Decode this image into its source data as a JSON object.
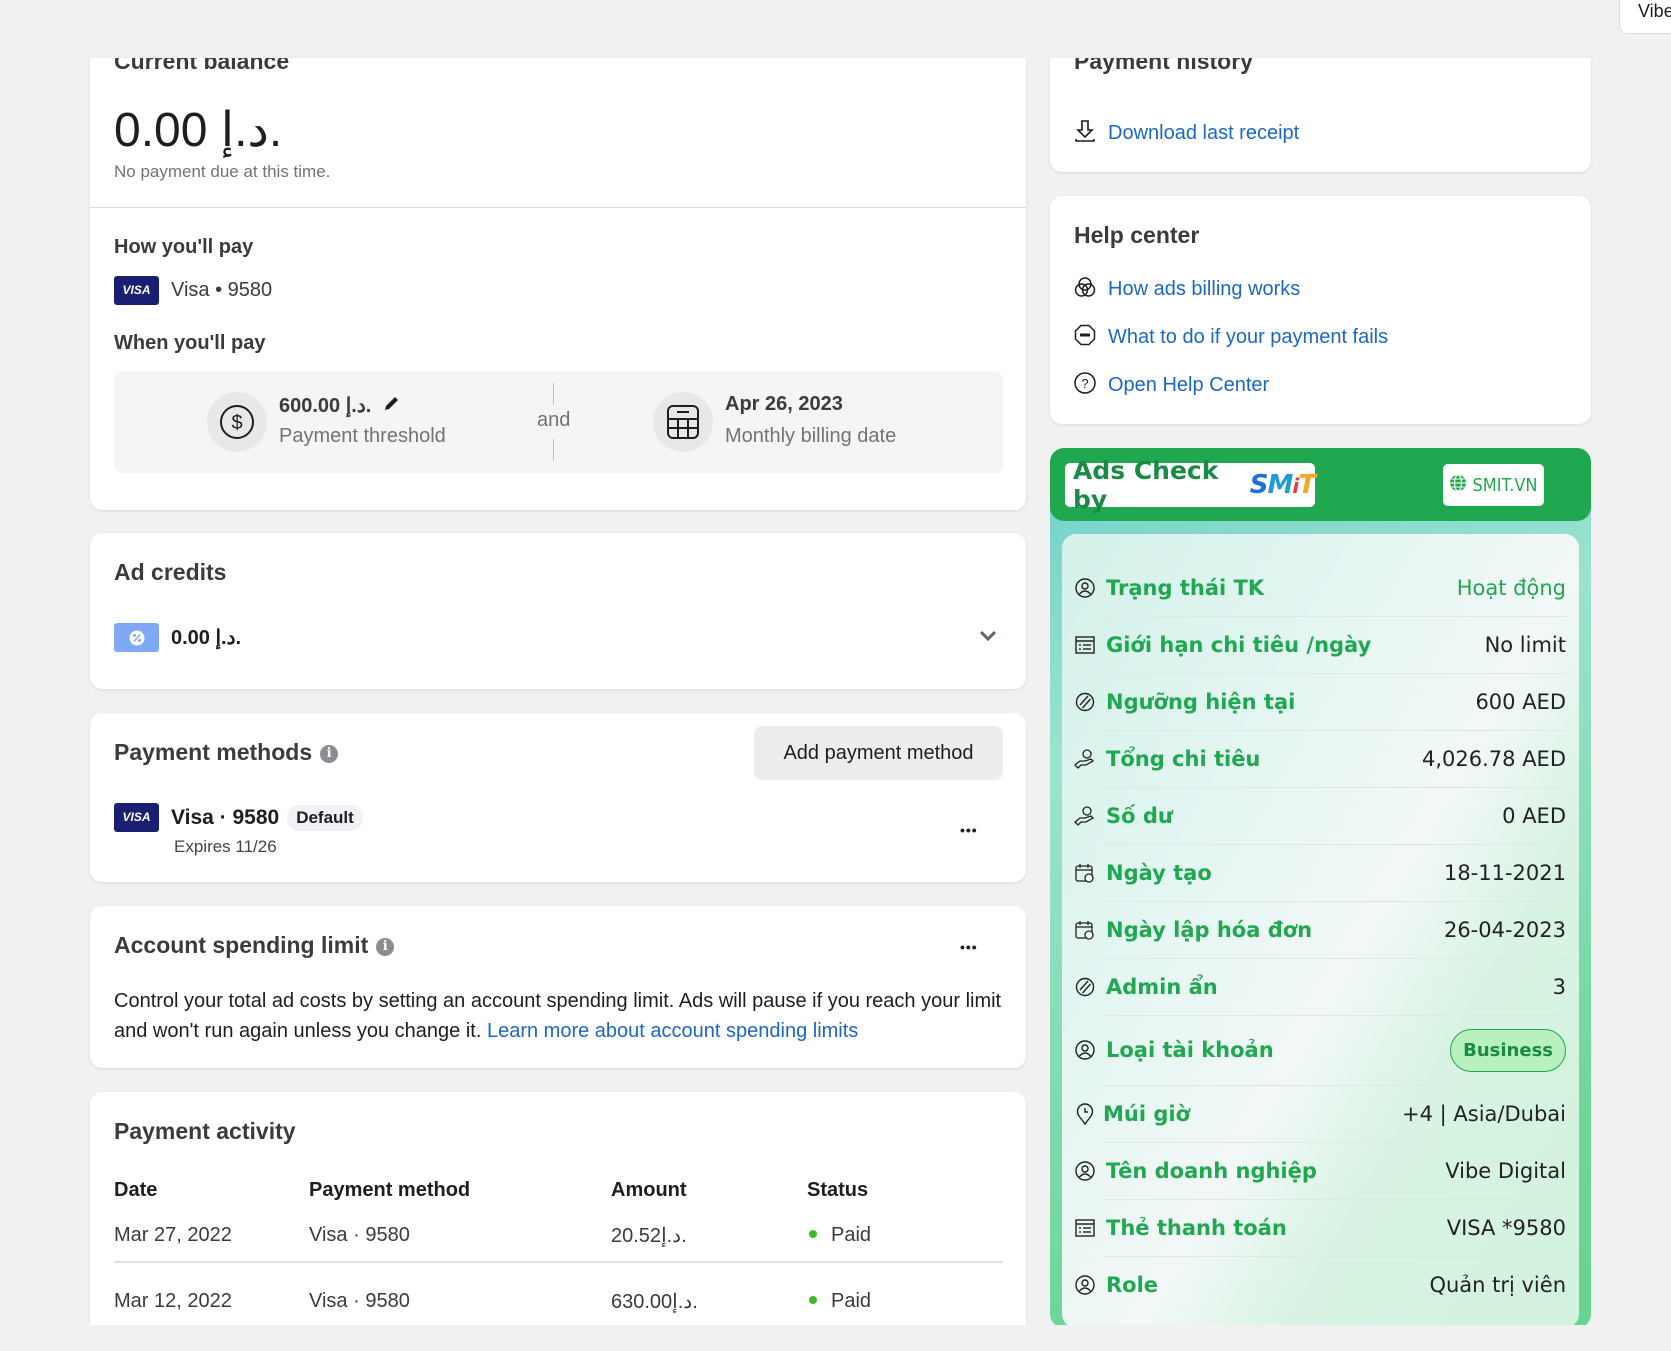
{
  "top_right": {
    "label": "Vibe"
  },
  "current_balance": {
    "title": "Current balance",
    "amount": "0.00 د.إ.",
    "note": "No payment due at this time.",
    "how_title": "How you'll pay",
    "card_brand": "VISA",
    "card_label": "Visa • 9580",
    "when_title": "When you'll pay",
    "threshold_amount": "600.00 د.إ.",
    "threshold_label": "Payment threshold",
    "and_label": "and",
    "billing_date": "Apr 26, 2023",
    "billing_label": "Monthly billing date"
  },
  "ad_credits": {
    "title": "Ad credits",
    "amount": "0.00 د.إ."
  },
  "payment_methods": {
    "title": "Payment methods",
    "add_button": "Add payment method",
    "card_brand": "VISA",
    "card_label": "Visa · 9580",
    "default_badge": "Default",
    "expires": "Expires 11/26",
    "more": "•••"
  },
  "spending_limit": {
    "title": "Account spending limit",
    "description": "Control your total ad costs by setting an account spending limit. Ads will pause if you reach your limit and won't run again unless you change it. ",
    "learn_more": "Learn more about account spending limits",
    "more": "•••"
  },
  "payment_activity": {
    "title": "Payment activity",
    "columns": [
      "Date",
      "Payment method",
      "Amount",
      "Status"
    ],
    "rows": [
      {
        "date": "Mar 27, 2022",
        "method": "Visa · 9580",
        "amount": "20.52د.إ.",
        "status": "Paid"
      },
      {
        "date": "Mar 12, 2022",
        "method": "Visa · 9580",
        "amount": "630.00د.إ.",
        "status": "Paid"
      }
    ],
    "status_color": "#42b72a"
  },
  "payment_history": {
    "title": "Payment history",
    "download_link": "Download last receipt"
  },
  "help_center": {
    "title": "Help center",
    "links": [
      {
        "icon": "venn-icon",
        "label": "How ads billing works"
      },
      {
        "icon": "stop-icon",
        "label": "What to do if your payment fails"
      },
      {
        "icon": "question-icon",
        "label": "Open Help Center"
      }
    ]
  },
  "ads_check": {
    "title": "Ads Check by",
    "brand": "SMIT",
    "site_button": "SMIT.VN",
    "accent": "#1fa84f",
    "rows": [
      {
        "icon": "user-icon",
        "label": "Trạng thái TK",
        "value": "Hoạt động",
        "value_green": true
      },
      {
        "icon": "list-icon",
        "label": "Giới hạn chi tiêu /ngày",
        "value": "No limit"
      },
      {
        "icon": "slash-circle-icon",
        "label": "Ngưỡng hiện tại",
        "value": "600 AED"
      },
      {
        "icon": "hand-coin-icon",
        "label": "Tổng chi tiêu",
        "value": "4,026.78 AED"
      },
      {
        "icon": "hand-coin-icon",
        "label": "Số dư",
        "value": "0 AED"
      },
      {
        "icon": "calendar-clock-icon",
        "label": "Ngày tạo",
        "value": "18-11-2021"
      },
      {
        "icon": "calendar-clock-icon",
        "label": "Ngày lập hóa đơn",
        "value": "26-04-2023"
      },
      {
        "icon": "slash-circle-icon",
        "label": "Admin ẩn",
        "value": "3"
      },
      {
        "icon": "user-icon",
        "label": "Loại tài khoản",
        "value": "Business",
        "badge": true
      },
      {
        "icon": "location-clock-icon",
        "label": "Múi giờ",
        "value": "+4 | Asia/Dubai"
      },
      {
        "icon": "user-icon",
        "label": "Tên doanh nghiệp",
        "value": "Vibe Digital"
      },
      {
        "icon": "list-icon",
        "label": "Thẻ thanh toán",
        "value": "VISA *9580"
      },
      {
        "icon": "user-icon",
        "label": "Role",
        "value": "Quản trị viên"
      }
    ]
  }
}
